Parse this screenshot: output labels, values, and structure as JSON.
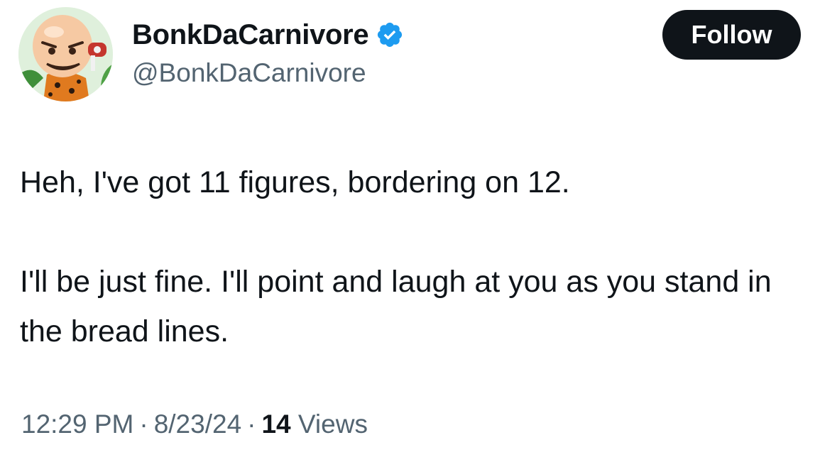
{
  "author": {
    "display_name": "BonkDaCarnivore",
    "handle": "@BonkDaCarnivore",
    "verified": true
  },
  "actions": {
    "follow_label": "Follow"
  },
  "tweet": {
    "paragraphs": [
      "Heh, I've got 11 figures, bordering on 12.",
      "I'll be just fine.  I'll point and laugh at you as you stand in the bread lines."
    ]
  },
  "meta": {
    "time": "12:29 PM",
    "date": "8/23/24",
    "separator": "·",
    "views_count": "14",
    "views_label": "Views"
  },
  "colors": {
    "verified_badge": "#1d9bf0",
    "follow_button_bg": "#0f1419",
    "secondary_text": "#536471"
  },
  "icons": {
    "avatar": "caveman-with-meat-avatar",
    "verified": "verified-badge-icon"
  }
}
